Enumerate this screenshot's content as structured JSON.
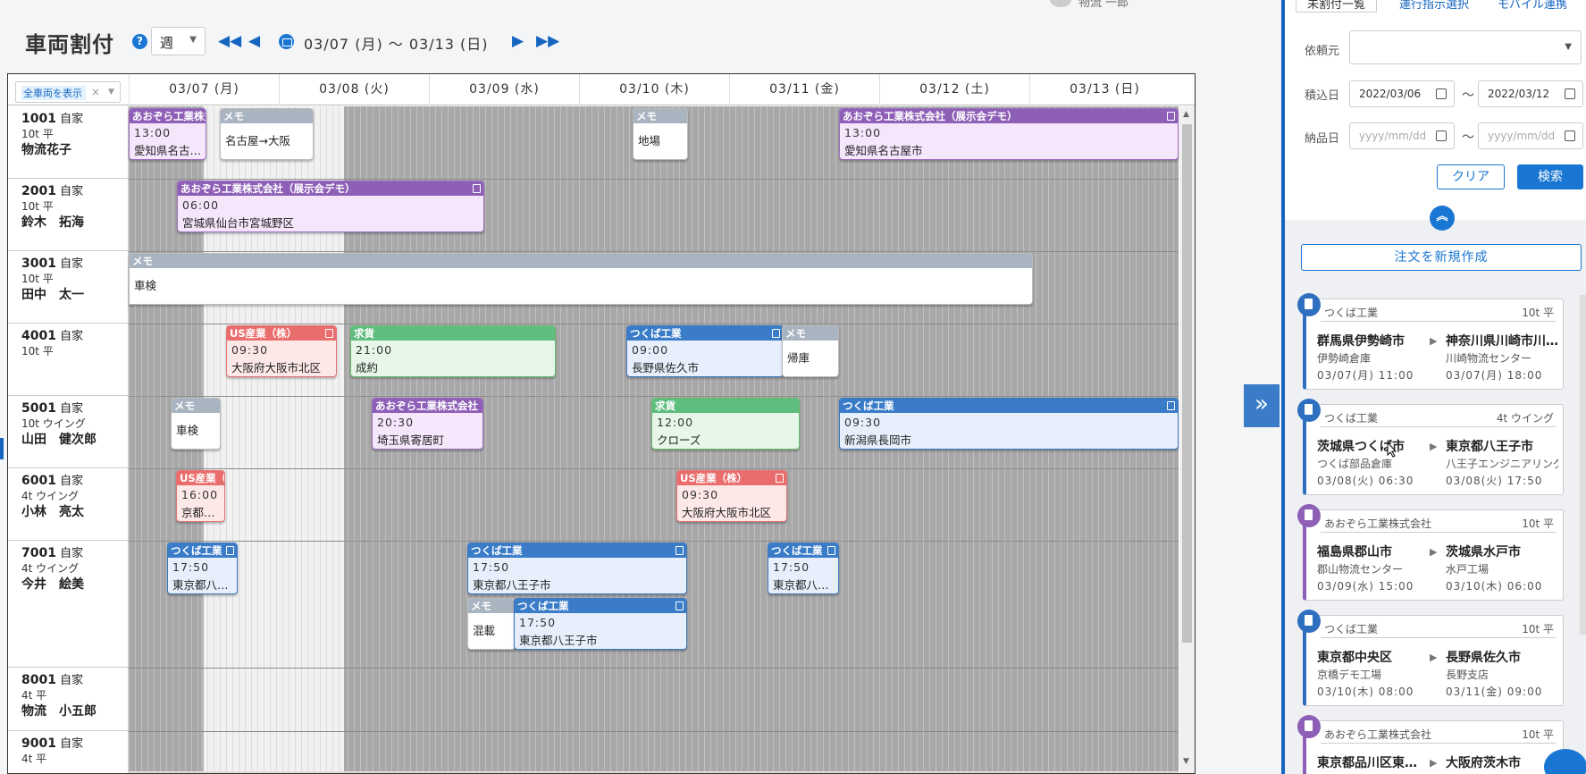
{
  "header": {
    "title": "車両割付",
    "view_select": "週",
    "date_range": "03/07 (月) 〜 03/13 (日)",
    "user_name": "物流 一郎"
  },
  "grid": {
    "vehicle_filter_tag": "全車両を表示",
    "days": [
      "03/07 (月)",
      "03/08 (火)",
      "03/09 (水)",
      "03/10 (木)",
      "03/11 (金)",
      "03/12 (土)",
      "03/13 (日)"
    ],
    "rows": [
      {
        "no": "1001",
        "ownership": "自家",
        "spec": "10t 平",
        "driver": "物流花子"
      },
      {
        "no": "2001",
        "ownership": "自家",
        "spec": "10t 平",
        "driver": "鈴木　拓海"
      },
      {
        "no": "3001",
        "ownership": "自家",
        "spec": "10t 平",
        "driver": "田中　太一"
      },
      {
        "no": "4001",
        "ownership": "自家",
        "spec": "10t 平",
        "driver": ""
      },
      {
        "no": "5001",
        "ownership": "自家",
        "spec": "10t ウイング",
        "driver": "山田　健次郎"
      },
      {
        "no": "6001",
        "ownership": "自家",
        "spec": "4t ウイング",
        "driver": "小林　亮太"
      },
      {
        "no": "7001",
        "ownership": "自家",
        "spec": "4t ウイング",
        "driver": "今井　絵美"
      },
      {
        "no": "8001",
        "ownership": "自家",
        "spec": "4t 平",
        "driver": "物流　小五郎"
      },
      {
        "no": "9001",
        "ownership": "自家",
        "spec": "4t 平",
        "driver": ""
      }
    ],
    "events": [
      {
        "header": "あおぞら工業株式会社",
        "time": "13:00",
        "place": "愛知県名古屋市"
      },
      {
        "header": "メモ",
        "time": "",
        "place": "名古屋→大阪"
      },
      {
        "header": "メモ",
        "time": "",
        "place": "地場"
      },
      {
        "header": "あおぞら工業株式会社（展示会デモ）",
        "time": "13:00",
        "place": "愛知県名古屋市"
      },
      {
        "header": "あおぞら工業株式会社（展示会デモ）",
        "time": "06:00",
        "place": "宮城県仙台市宮城野区"
      },
      {
        "header": "メモ",
        "time": "",
        "place": "車検"
      },
      {
        "header": "US産業（株）",
        "time": "09:30",
        "place": "大阪府大阪市北区"
      },
      {
        "header": "求貨",
        "time": "21:00",
        "place": "成約"
      },
      {
        "header": "つくば工業",
        "time": "09:00",
        "place": "長野県佐久市"
      },
      {
        "header": "メモ",
        "time": "",
        "place": "帰庫"
      },
      {
        "header": "メモ",
        "time": "",
        "place": "車検"
      },
      {
        "header": "あおぞら工業株式会社",
        "time": "20:30",
        "place": "埼玉県寄居町"
      },
      {
        "header": "求貨",
        "time": "12:00",
        "place": "クローズ"
      },
      {
        "header": "つくば工業",
        "time": "09:30",
        "place": "新潟県長岡市"
      },
      {
        "header": "US産業（株）",
        "time": "16:00",
        "place": "京都府京都市"
      },
      {
        "header": "US産業（株）",
        "time": "09:30",
        "place": "大阪府大阪市北区"
      },
      {
        "header": "つくば工業",
        "time": "17:50",
        "place": "東京都八王子市"
      },
      {
        "header": "つくば工業",
        "time": "17:50",
        "place": "東京都八王子市"
      },
      {
        "header": "つくば工業",
        "time": "17:50",
        "place": "東京都八王子市"
      },
      {
        "header": "メモ",
        "time": "",
        "place": "混載"
      },
      {
        "header": "つくば工業",
        "time": "17:50",
        "place": "東京都八王子市"
      }
    ]
  },
  "panel": {
    "tabs": [
      "未割付一覧",
      "運行指示選択",
      "モバイル連携"
    ],
    "client_label": "依頼元",
    "client_value": "",
    "load_label": "積込日",
    "load_from": "2022/03/06",
    "load_to": "2022/03/12",
    "deliver_label": "納品日",
    "date_placeholder": "yyyy/mm/dd",
    "range_sep": "〜",
    "clear_button": "クリア",
    "search_button": "検索",
    "new_order_button": "注文を新規作成",
    "orders": [
      {
        "client": "つくば工業",
        "vehicle": "10t 平",
        "from": "群馬県伊勢崎市",
        "to": "神奈川県川崎市川崎区",
        "from_site": "伊勢崎倉庫",
        "to_site": "川崎物流センター",
        "from_time": "03/07(月) 11:00",
        "to_time": "03/07(月) 18:00"
      },
      {
        "client": "つくば工業",
        "vehicle": "4t ウイング",
        "from": "茨城県つくば市",
        "to": "東京都八王子市",
        "from_site": "つくば部品倉庫",
        "to_site": "八王子エンジニアリング",
        "from_time": "03/08(火) 06:30",
        "to_time": "03/08(火) 17:50"
      },
      {
        "client": "あおぞら工業株式会社",
        "vehicle": "10t 平",
        "from": "福島県郡山市",
        "to": "茨城県水戸市",
        "from_site": "郡山物流センター",
        "to_site": "水戸工場",
        "from_time": "03/09(水) 15:00",
        "to_time": "03/10(木) 06:00"
      },
      {
        "client": "つくば工業",
        "vehicle": "10t 平",
        "from": "東京都中央区",
        "to": "長野県佐久市",
        "from_site": "京橋デモ工場",
        "to_site": "長野支店",
        "from_time": "03/10(木) 08:00",
        "to_time": "03/11(金) 09:00"
      },
      {
        "client": "あおぞら工業株式会社",
        "vehicle": "10t 平",
        "from": "東京都品川区東品川",
        "to": "大阪府茨木市",
        "from_site": "",
        "to_site": "",
        "from_time": "",
        "to_time": ""
      }
    ]
  }
}
